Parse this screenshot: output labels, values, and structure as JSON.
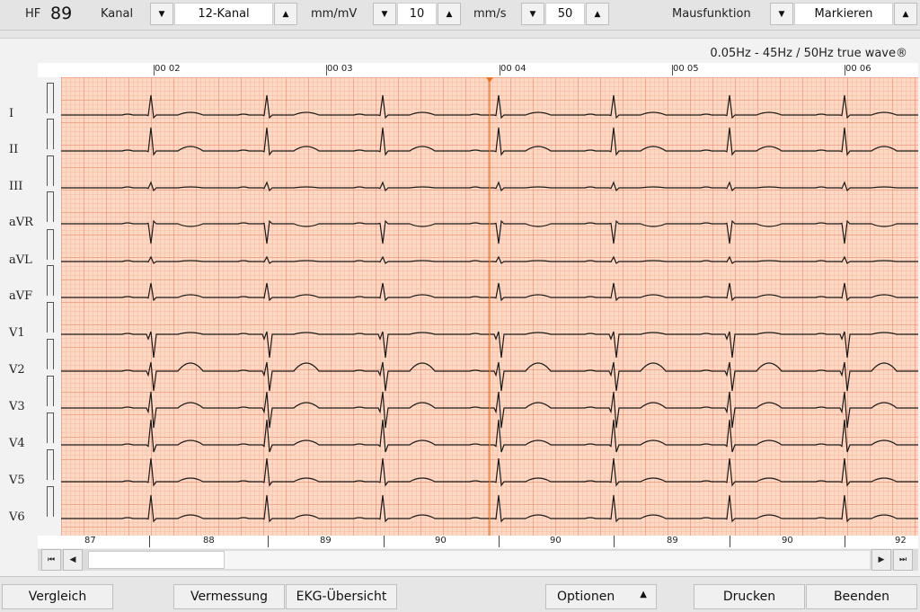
{
  "toolbar": {
    "hf_label": "HF",
    "hf_value": "89",
    "kanal_label": "Kanal",
    "kanal_value": "12-Kanal",
    "mmmv_label": "mm/mV",
    "mmmv_value": "10",
    "mms_label": "mm/s",
    "mms_value": "50",
    "maus_label": "Mausfunktion",
    "maus_value": "Markieren"
  },
  "panel": {
    "filter_info": "0.05Hz - 45Hz / 50Hz true wave®",
    "time_labels": [
      "00 02",
      "00 03",
      "00 04",
      "00 05",
      "00 06"
    ],
    "leads": [
      "I",
      "II",
      "III",
      "aVR",
      "aVL",
      "aVF",
      "V1",
      "V2",
      "V3",
      "V4",
      "V5",
      "V6"
    ],
    "hr_values": [
      "87",
      "88",
      "89",
      "90",
      "90",
      "89",
      "90",
      "92"
    ]
  },
  "bottom": {
    "vergleich": "Vergleich",
    "vermessung": "Vermessung",
    "ekg_uebersicht": "EKG-Übersicht",
    "optionen": "Optionen",
    "drucken": "Drucken",
    "beenden": "Beenden"
  },
  "colors": {
    "grid_bg": "#fdd9c4",
    "trace": "#1a1a1a",
    "marker": "#e8731a"
  }
}
